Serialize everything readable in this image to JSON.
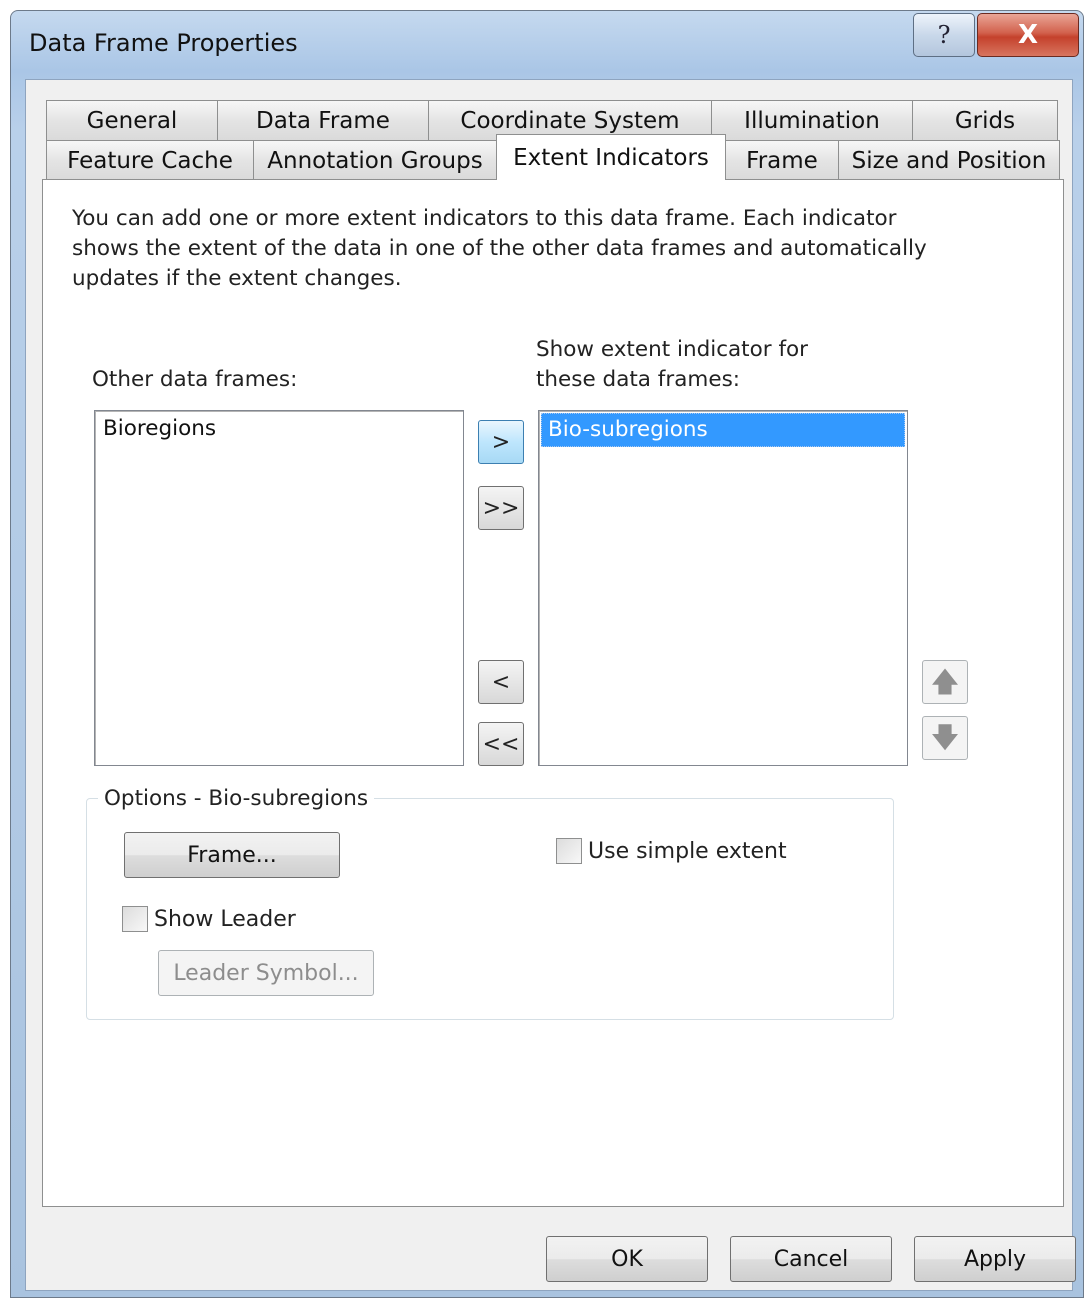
{
  "window": {
    "title": "Data Frame Properties",
    "help_glyph": "?",
    "close_glyph": "X"
  },
  "tabs": {
    "back_row": [
      "General",
      "Data Frame",
      "Coordinate System",
      "Illumination",
      "Grids"
    ],
    "front_row": [
      "Feature Cache",
      "Annotation Groups",
      "Extent Indicators",
      "Frame",
      "Size and Position"
    ],
    "active": "Extent Indicators"
  },
  "panel": {
    "description_lines": [
      "You can add one or more extent indicators to this data frame.  Each indicator",
      "shows the extent of the data in one of the other data frames and automatically",
      "updates if the extent changes."
    ],
    "other_label": "Other data frames:",
    "show_label_lines": [
      "Show extent indicator for",
      "these data frames:"
    ],
    "other_list": [
      "Bioregions"
    ],
    "show_list": [
      "Bio-subregions"
    ],
    "show_list_selected": "Bio-subregions",
    "move_buttons": {
      "add_one": ">",
      "add_all": ">>",
      "remove_one": "<",
      "remove_all": "<<",
      "up": "🡅",
      "down": "🡇"
    },
    "options": {
      "legend": "Options - Bio-subregions",
      "frame_button": "Frame...",
      "simple_extent_label": "Use simple extent",
      "simple_extent_checked": false,
      "show_leader_label": "Show Leader",
      "show_leader_checked": false,
      "leader_symbol_button": "Leader Symbol..."
    }
  },
  "footer": {
    "ok": "OK",
    "cancel": "Cancel",
    "apply": "Apply"
  }
}
